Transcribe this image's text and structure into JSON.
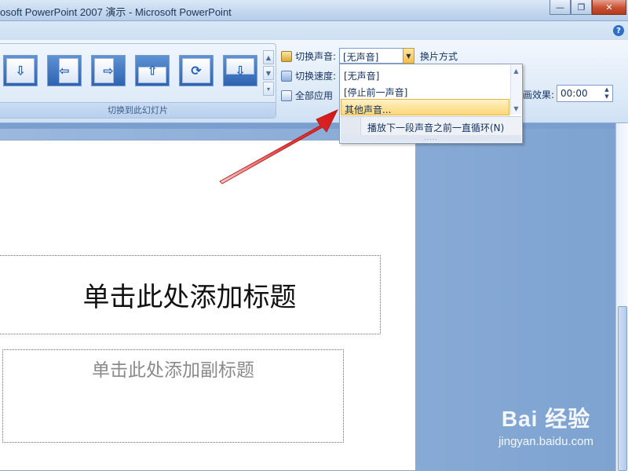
{
  "window": {
    "title": "osoft PowerPoint 2007 演示 - Microsoft PowerPoint",
    "minimize": "—",
    "restore": "❐",
    "close": "✕"
  },
  "ribbon": {
    "help": "?",
    "group_label": "切换到此幻灯片",
    "transition_icons": [
      "wipe-down-icon",
      "push-left-icon",
      "push-right-icon",
      "push-up-icon",
      "wheel-icon",
      "cover-down-icon"
    ],
    "sound_label": "切换声音:",
    "sound_value": "[无声音]",
    "speed_label": "切换速度:",
    "apply_all_label": "全部应用",
    "switch_mode_label": "换片方式",
    "effect_label": "画效果:",
    "time_value": "00:00"
  },
  "dropdown": {
    "items": [
      "[无声音]",
      "[停止前一声音]",
      "其他声音..."
    ],
    "selected_index": 2,
    "loop_option": "播放下一段声音之前一直循环(N)",
    "grip": "....."
  },
  "slide": {
    "title_placeholder": "单击此处添加标题",
    "subtitle_placeholder": "单击此处添加副标题"
  },
  "watermark": {
    "brand": "Bai 经验",
    "url": "jingyan.baidu.com"
  },
  "colors": {
    "accent_red": "#e02020",
    "selection": "#fcd776"
  }
}
